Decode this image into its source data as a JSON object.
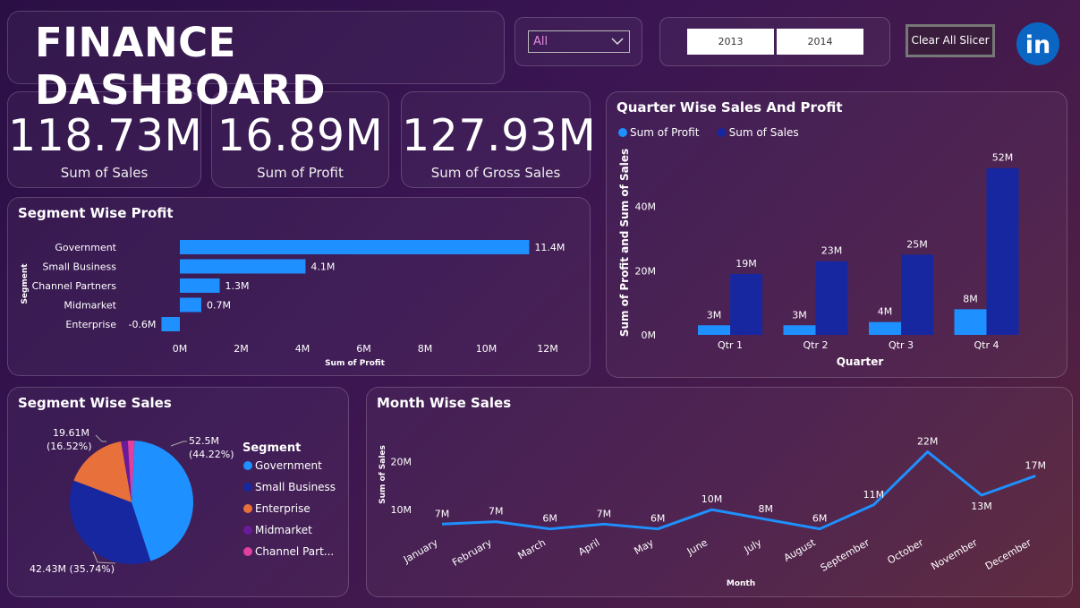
{
  "title": "FINANCE DASHBOARD",
  "filter": {
    "selected": "All"
  },
  "years": [
    "2013",
    "2014"
  ],
  "clear_button": "Clear All Slicer",
  "linkedin_icon": "linkedin-icon",
  "kpis": [
    {
      "value": "118.73M",
      "label": "Sum of  Sales"
    },
    {
      "value": "16.89M",
      "label": "Sum of Profit"
    },
    {
      "value": "127.93M",
      "label": "Sum of Gross Sales"
    }
  ],
  "colors": {
    "profit": "#1e90ff",
    "sales": "#1727a0",
    "enterprise": "#e8703a",
    "midmarket": "#6a1b9a",
    "channel": "#e040a0"
  },
  "chart_data": [
    {
      "type": "bar",
      "orientation": "horizontal",
      "title": "Segment Wise Profit",
      "ylabel": "Segment",
      "xlabel": "Sum of Profit",
      "categories": [
        "Government",
        "Small Business",
        "Channel Partners",
        "Midmarket",
        "Enterprise"
      ],
      "values": [
        11.4,
        4.1,
        1.3,
        0.7,
        -0.6
      ],
      "data_labels": [
        "11.4M",
        "4.1M",
        "1.3M",
        "0.7M",
        "-0.6M"
      ],
      "xticks": [
        "0M",
        "2M",
        "4M",
        "6M",
        "8M",
        "10M",
        "12M"
      ],
      "xlim": [
        0,
        12
      ]
    },
    {
      "type": "bar",
      "title": "Quarter Wise Sales And Profit",
      "xlabel": "Quarter",
      "ylabel": "Sum of Profit and Sum of Sales",
      "legend": "top-left",
      "categories": [
        "Qtr 1",
        "Qtr 2",
        "Qtr 3",
        "Qtr 4"
      ],
      "series": [
        {
          "name": "Sum of Profit",
          "values": [
            3,
            3,
            4,
            8
          ],
          "labels": [
            "3M",
            "3M",
            "4M",
            "8M"
          ]
        },
        {
          "name": "Sum of  Sales",
          "values": [
            19,
            23,
            25,
            52
          ],
          "labels": [
            "19M",
            "23M",
            "25M",
            "52M"
          ]
        }
      ],
      "yticks": [
        "0M",
        "20M",
        "40M"
      ],
      "ylim": [
        0,
        55
      ]
    },
    {
      "type": "pie",
      "title": "Segment Wise Sales",
      "legend_title": "Segment",
      "categories": [
        "Government",
        "Small Business",
        "Enterprise",
        "Midmarket",
        "Channel Part..."
      ],
      "values": [
        52.5,
        42.43,
        19.61,
        2.1,
        2.1
      ],
      "data_labels": [
        "52.5M\n(44.22%)",
        "42.43M (35.74%)",
        "19.61M\n(16.52%)"
      ]
    },
    {
      "type": "line",
      "title": "Month Wise Sales",
      "xlabel": "Month",
      "ylabel": "Sum of Sales",
      "categories": [
        "January",
        "February",
        "March",
        "April",
        "May",
        "June",
        "July",
        "August",
        "September",
        "October",
        "November",
        "December"
      ],
      "values": [
        7,
        7.5,
        6,
        7,
        6,
        10,
        8,
        6,
        11,
        22,
        13,
        17
      ],
      "data_labels": [
        "7M",
        "7M",
        "6M",
        "7M",
        "6M",
        "10M",
        "8M",
        "6M",
        "11M",
        "22M",
        "13M",
        "17M"
      ],
      "yticks": [
        "10M",
        "20M"
      ],
      "ylim": [
        0,
        26
      ]
    }
  ]
}
